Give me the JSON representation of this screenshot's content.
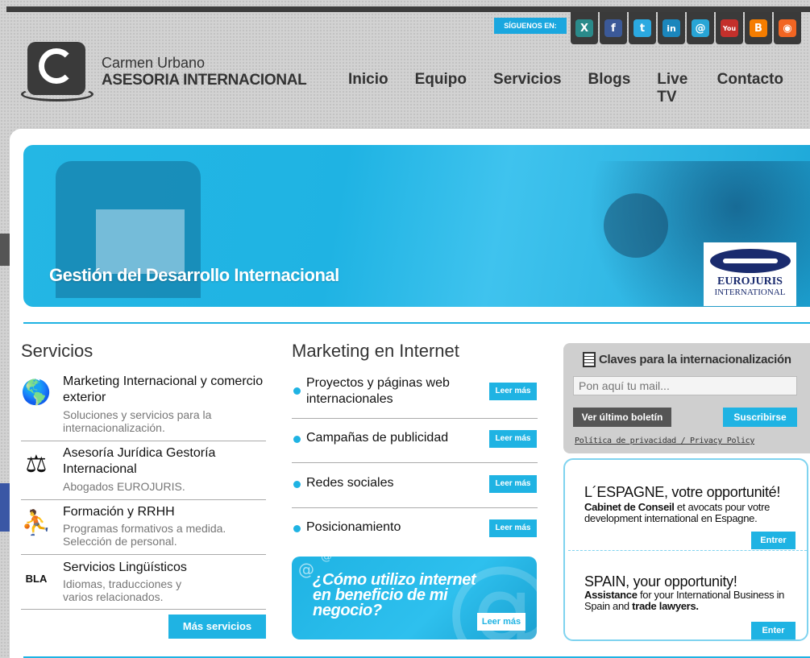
{
  "header": {
    "follow_label": "SÍGUENOS EN:",
    "brand_line1": "Carmen Urbano",
    "brand_line2": "ASESORIA INTERNACIONAL",
    "socials": [
      {
        "name": "xing",
        "glyph": "X",
        "color": "#2a8a8a"
      },
      {
        "name": "facebook",
        "glyph": "f",
        "color": "#3b5998"
      },
      {
        "name": "twitter",
        "glyph": "t",
        "color": "#2ba9e1"
      },
      {
        "name": "linkedin",
        "glyph": "in",
        "color": "#1b86bc"
      },
      {
        "name": "email",
        "glyph": "@",
        "color": "#28a5d6"
      },
      {
        "name": "youtube",
        "glyph": "You",
        "color": "#c4302b"
      },
      {
        "name": "blogger",
        "glyph": "B",
        "color": "#f57d00"
      },
      {
        "name": "rss",
        "glyph": "◉",
        "color": "#f26522"
      }
    ],
    "nav": [
      "Inicio",
      "Equipo",
      "Servicios",
      "Blogs",
      "Live TV",
      "Contacto"
    ]
  },
  "hero": {
    "title": "Gestión del Desarrollo Internacional",
    "partner_line1": "EUROJURIS",
    "partner_line2": "INTERNATIONAL"
  },
  "servicios": {
    "title": "Servicios",
    "items": [
      {
        "title": "Marketing Internacional y comercio exterior",
        "desc": "Soluciones y servicios para la internacionalización.",
        "icon": "globe-icon",
        "glyph": "🌎"
      },
      {
        "title": "Asesoría Jurídica Gestoría Internacional",
        "desc": "Abogados EUROJURIS.",
        "icon": "scales-icon",
        "glyph": "⚖"
      },
      {
        "title": "Formación y RRHH",
        "desc": "Programas formativos a medida. Selección de personal.",
        "icon": "people-icon",
        "glyph": "⛹"
      },
      {
        "title": "Servicios Lingüísticos",
        "desc": "Idiomas, traducciones y varios relacionados.",
        "icon": "speech-icon",
        "glyph": "BLA"
      }
    ],
    "more_label": "Más servicios"
  },
  "marketing": {
    "title": "Marketing en Internet",
    "items": [
      {
        "label": "Proyectos y páginas web internacionales",
        "button": "Leer más"
      },
      {
        "label": "Campañas de publicidad",
        "button": "Leer más"
      },
      {
        "label": "Redes sociales",
        "button": "Leer más"
      },
      {
        "label": "Posicionamiento",
        "button": "Leer más"
      }
    ],
    "promo_text": "¿Cómo utilizo internet en beneficio de mi negocio?",
    "promo_button": "Leer más"
  },
  "newsletter": {
    "title": "Claves para la internacionalización",
    "placeholder": "Pon aquí tu mail...",
    "last_label": "Ver último boletín",
    "subscribe_label": "Suscribirse",
    "privacy_label": "Política de privacidad / Privacy Policy"
  },
  "offers": [
    {
      "heading": "L´ESPAGNE, votre opportunité!",
      "bold1": "Cabinet de Conseil",
      "rest1": " et avocats pour votre development international en Espagne.",
      "button": "Entrer"
    },
    {
      "heading": "SPAIN, your opportunity!",
      "bold1": "Assistance",
      "rest1": " for your International Business in Spain and ",
      "bold2": "trade lawyers.",
      "button": "Enter"
    }
  ],
  "colors": {
    "accent": "#1fb3e3",
    "dark": "#3a3a3a"
  }
}
